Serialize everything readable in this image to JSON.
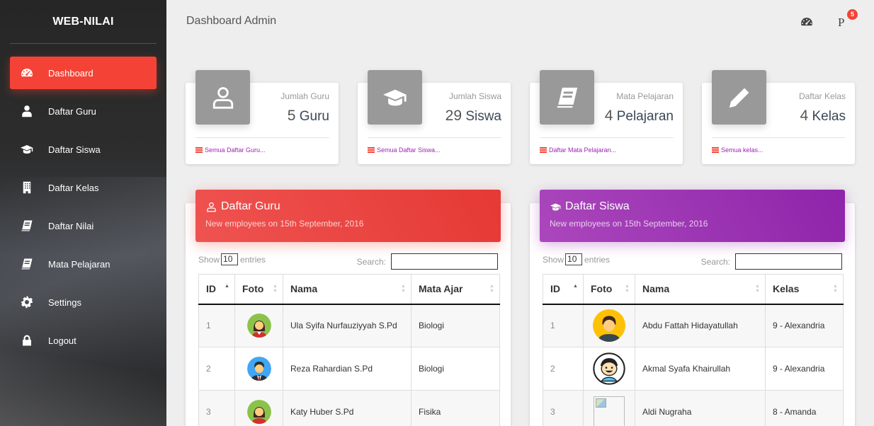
{
  "sidebar": {
    "brand": "WEB-NILAI",
    "items": [
      {
        "label": "Dashboard",
        "icon": "dashboard-icon",
        "active": true
      },
      {
        "label": "Daftar Guru",
        "icon": "user-icon"
      },
      {
        "label": "Daftar Siswa",
        "icon": "graduation-cap-icon"
      },
      {
        "label": "Daftar Kelas",
        "icon": "building-icon"
      },
      {
        "label": "Daftar Nilai",
        "icon": "book-icon"
      },
      {
        "label": "Mata Pelajaran",
        "icon": "book-icon"
      },
      {
        "label": "Settings",
        "icon": "gear-icon"
      },
      {
        "label": "Logout",
        "icon": "lock-icon"
      }
    ]
  },
  "topbar": {
    "title": "Dashboard Admin",
    "profile_label": "P",
    "notification_count": "5"
  },
  "stats": [
    {
      "category": "Jumlah Guru",
      "value": "5",
      "unit": "Guru",
      "footer": "Semua Daftar Guru...",
      "icon": "user-outline-icon"
    },
    {
      "category": "Jumlah Siswa",
      "value": "29",
      "unit": "Siswa",
      "footer": "Semua Daftar Siswa...",
      "icon": "graduation-cap-icon"
    },
    {
      "category": "Mata Pelajaran",
      "value": "4",
      "unit": "Pelajaran",
      "footer": "Daftar Mata Pelajaran...",
      "icon": "book-icon"
    },
    {
      "category": "Daftar Kelas",
      "value": "4",
      "unit": "Kelas",
      "footer": "Semua kelas...",
      "icon": "pencil-icon"
    }
  ],
  "guru_table": {
    "title": "Daftar Guru",
    "subtitle": "New employees on 15th September, 2016",
    "show_label": "Show",
    "entries_value": "10",
    "entries_label": "entries",
    "search_label": "Search:",
    "columns": [
      "ID",
      "Foto",
      "Nama",
      "Mata Ajar"
    ],
    "rows": [
      {
        "id": "1",
        "nama": "Ula Syifa Nurfauziyyah S.Pd",
        "mapel": "Biologi"
      },
      {
        "id": "2",
        "nama": "Reza Rahardian S.Pd",
        "mapel": "Biologi"
      },
      {
        "id": "3",
        "nama": "Katy Huber S.Pd",
        "mapel": "Fisika"
      }
    ]
  },
  "siswa_table": {
    "title": "Daftar Siswa",
    "subtitle": "New employees on 15th September, 2016",
    "show_label": "Show",
    "entries_value": "10",
    "entries_label": "entries",
    "search_label": "Search:",
    "columns": [
      "ID",
      "Foto",
      "Nama",
      "Kelas"
    ],
    "rows": [
      {
        "id": "1",
        "nama": "Abdu Fattah Hidayatullah",
        "kelas": "9 - Alexandria"
      },
      {
        "id": "2",
        "nama": "Akmal Syafa Khairullah",
        "kelas": "9 - Alexandria"
      },
      {
        "id": "3",
        "nama": "Aldi Nugraha",
        "kelas": "8 - Amanda"
      }
    ]
  },
  "colors": {
    "accent_red": "#f44336",
    "accent_purple": "#9c27b0",
    "stat_icon_bg": "#999999"
  }
}
